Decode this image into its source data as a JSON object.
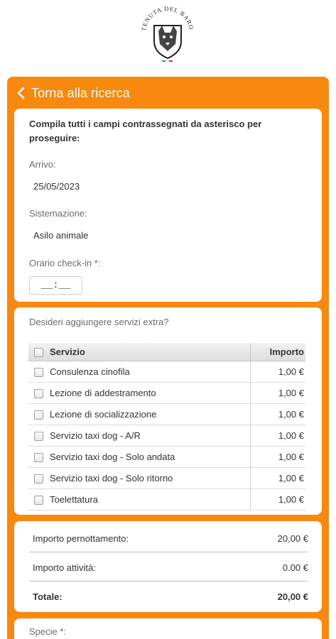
{
  "logo": {
    "text": "TENUTA DEL BARONE",
    "name": "tenuta-del-barone-logo"
  },
  "header": {
    "back_label": "Torna alla ricerca"
  },
  "booking": {
    "intro": "Compila tutti i campi contrassegnati da asterisco per proseguire:",
    "arrival_label": "Arrivo:",
    "arrival_value": "25/05/2023",
    "accommodation_label": "Sistemazione:",
    "accommodation_value": "Asilo animale",
    "checkin_label": "Orario check-in *:",
    "checkin_placeholder": "__:__"
  },
  "extras": {
    "question": "Desideri aggiungere servizi extra?",
    "columns": {
      "service": "Servizio",
      "amount": "Importo"
    },
    "rows": [
      {
        "name": "Consulenza cinofila",
        "amount": "1,00 €",
        "checked": false
      },
      {
        "name": "Lezione di addestramento",
        "amount": "1,00 €",
        "checked": false
      },
      {
        "name": "Lezione di socializzazione",
        "amount": "1,00 €",
        "checked": false
      },
      {
        "name": "Servizio taxi dog - A/R",
        "amount": "1,00 €",
        "checked": false
      },
      {
        "name": "Servizio taxi dog - Solo andata",
        "amount": "1,00 €",
        "checked": false
      },
      {
        "name": "Servizio taxi dog - Solo ritorno",
        "amount": "1,00 €",
        "checked": false
      },
      {
        "name": "Toelettatura",
        "amount": "1,00 €",
        "checked": false
      }
    ]
  },
  "summary": {
    "overnight_label": "Importo pernottamento:",
    "overnight_value": "20,00 €",
    "activities_label": "Importo attività:",
    "activities_value": "0.00 €",
    "total_label": "Totale:",
    "total_value": "20,00 €"
  },
  "species": {
    "label": "Specie *:"
  },
  "colors": {
    "accent": "#f7890e",
    "card": "#ffffff"
  }
}
